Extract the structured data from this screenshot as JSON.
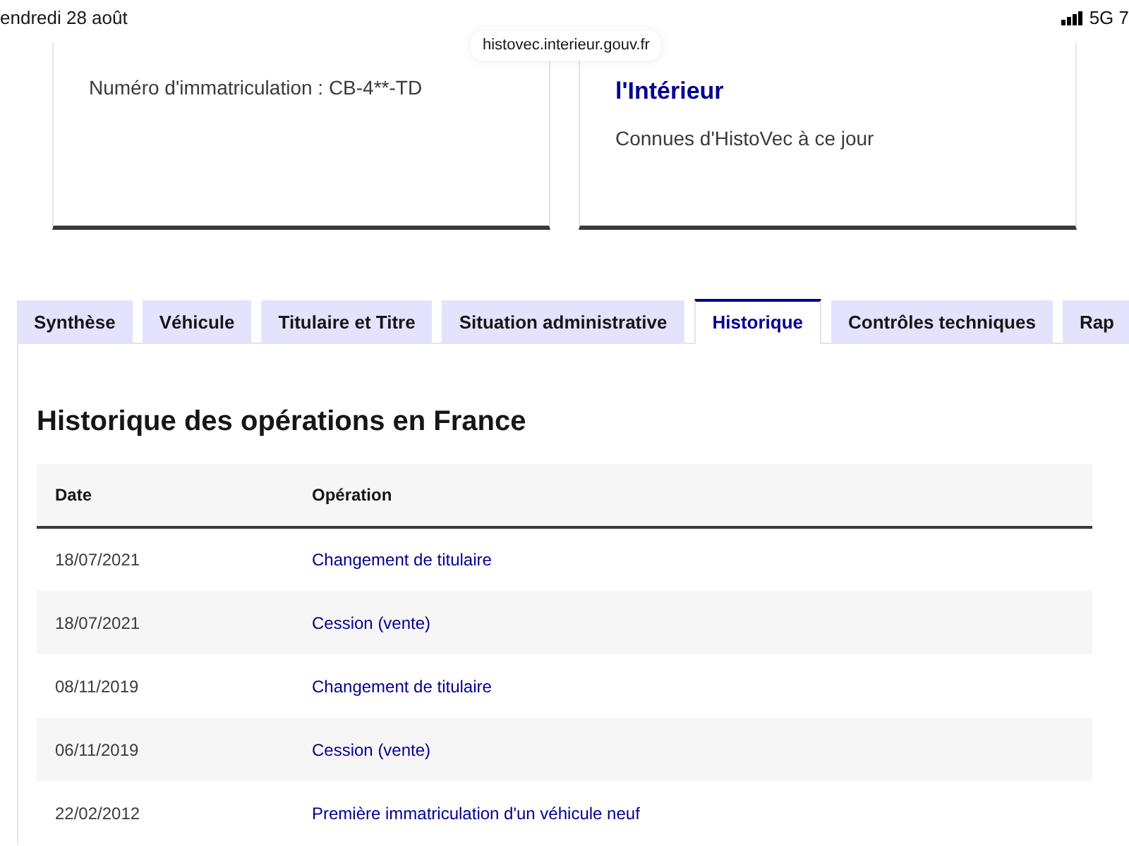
{
  "status_bar": {
    "date": "endredi 28 août",
    "network": "5G 7"
  },
  "url_bar": {
    "url": "histovec.interieur.gouv.fr"
  },
  "cards": [
    {
      "text": "Numéro d'immatriculation : CB-4**-TD"
    },
    {
      "title": "l'Intérieur",
      "text": "Connues d'HistoVec à ce jour"
    }
  ],
  "tabs": [
    {
      "label": "Synthèse",
      "selected": false
    },
    {
      "label": "Véhicule",
      "selected": false
    },
    {
      "label": "Titulaire et Titre",
      "selected": false
    },
    {
      "label": "Situation administrative",
      "selected": false
    },
    {
      "label": "Historique",
      "selected": true
    },
    {
      "label": "Contrôles techniques",
      "selected": false
    },
    {
      "label": "Rap",
      "selected": false
    }
  ],
  "section": {
    "title": "Historique des opérations en France"
  },
  "table": {
    "columns": [
      "Date",
      "Opération"
    ],
    "rows": [
      [
        "18/07/2021",
        "Changement de titulaire"
      ],
      [
        "18/07/2021",
        "Cession (vente)"
      ],
      [
        "08/11/2019",
        "Changement de titulaire"
      ],
      [
        "06/11/2019",
        "Cession (vente)"
      ],
      [
        "22/02/2012",
        "Première immatriculation d'un véhicule neuf"
      ]
    ]
  }
}
